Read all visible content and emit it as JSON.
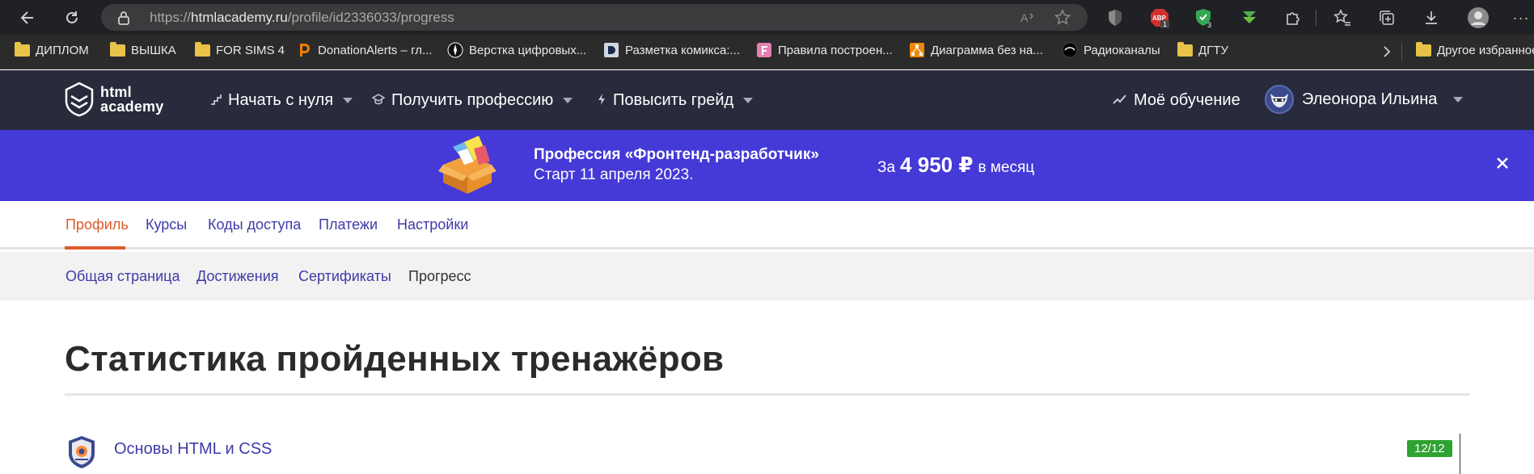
{
  "browser": {
    "url_prefix": "https://",
    "url_domain": "htmlacademy.ru",
    "url_path": "/profile/id2336033/progress",
    "abp_count": "1",
    "shield_count": "3"
  },
  "bookmarks": [
    {
      "label": "ДИПЛОМ",
      "icon": "folder-icon"
    },
    {
      "label": "ВЫШКА",
      "icon": "folder-icon"
    },
    {
      "label": "FOR SIMS 4",
      "icon": "folder-icon"
    },
    {
      "label": "DonationAlerts – гл...",
      "icon": "donationalerts-icon"
    },
    {
      "label": "Верстка цифровых...",
      "icon": "compass-icon"
    },
    {
      "label": "Разметка комикса:...",
      "icon": "d-icon"
    },
    {
      "label": "Правила построен...",
      "icon": "f-icon"
    },
    {
      "label": "Диаграмма без на...",
      "icon": "diagram-icon"
    },
    {
      "label": "Радиоканалы",
      "icon": "radio-icon"
    },
    {
      "label": "ДГТУ",
      "icon": "folder-icon"
    }
  ],
  "bookmarks_other": "Другое избранное",
  "site": {
    "logo_line1": "html",
    "logo_line2": "academy",
    "nav": [
      {
        "label": "Начать с нуля"
      },
      {
        "label": "Получить профессию"
      },
      {
        "label": "Повысить грейд"
      }
    ],
    "my_learning": "Моё обучение",
    "user_name": "Элеонора Ильина"
  },
  "promo": {
    "title": "Профессия «Фронтенд-разработчик»",
    "subtitle": "Старт 11 апреля 2023.",
    "price_prefix": "За",
    "price_amount": "4 950 ₽",
    "price_suffix": "в месяц"
  },
  "tabs": [
    "Профиль",
    "Курсы",
    "Коды доступа",
    "Платежи",
    "Настройки"
  ],
  "subtabs": [
    "Общая страница",
    "Достижения",
    "Сертификаты",
    "Прогресс"
  ],
  "page_title": "Статистика пройденных тренажёров",
  "courses": [
    {
      "name": "Основы HTML и CSS",
      "progress": "12/12"
    }
  ],
  "colors": {
    "header_bg": "#282b3b",
    "promo_bg": "#4539d7",
    "link": "#3f3ba8",
    "active_tab": "#dd5a2b",
    "badge_green": "#2fa332"
  }
}
